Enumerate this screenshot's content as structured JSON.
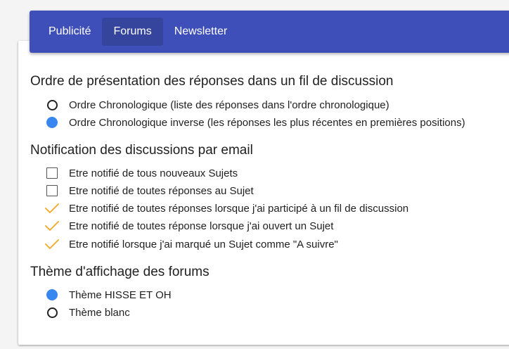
{
  "nav": {
    "items": [
      {
        "label": "Publicité",
        "active": false
      },
      {
        "label": "Forums",
        "active": true
      },
      {
        "label": "Newsletter",
        "active": false
      }
    ]
  },
  "colors": {
    "navbar": "#3f4fb9",
    "navbar_active": "#35449d",
    "radio_selected": "#3a86f0",
    "check_mark": "#f5a623"
  },
  "order": {
    "title": "Ordre de présentation des réponses dans un fil de discussion",
    "options": [
      {
        "label": "Ordre Chronologique (liste des réponses dans l'ordre chronologique)",
        "selected": false
      },
      {
        "label": "Ordre Chronologique inverse (les réponses les plus récentes en premières positions)",
        "selected": true
      }
    ]
  },
  "notify": {
    "title": "Notification des discussions par email",
    "options": [
      {
        "label": "Etre notifié de tous nouveaux Sujets",
        "checked": false
      },
      {
        "label": "Etre notifié de toutes réponses au Sujet",
        "checked": false
      },
      {
        "label": "Etre notifié de toutes réponses lorsque j'ai participé à un fil de discussion",
        "checked": true
      },
      {
        "label": "Etre notifié de toutes réponse lorsque j'ai ouvert un Sujet",
        "checked": true
      },
      {
        "label": "Etre notifié lorsque j'ai marqué un Sujet comme \"A suivre\"",
        "checked": true
      }
    ]
  },
  "theme": {
    "title": "Thème d'affichage des forums",
    "options": [
      {
        "label": "Thème HISSE ET OH",
        "selected": true
      },
      {
        "label": "Thème blanc",
        "selected": false
      }
    ]
  }
}
